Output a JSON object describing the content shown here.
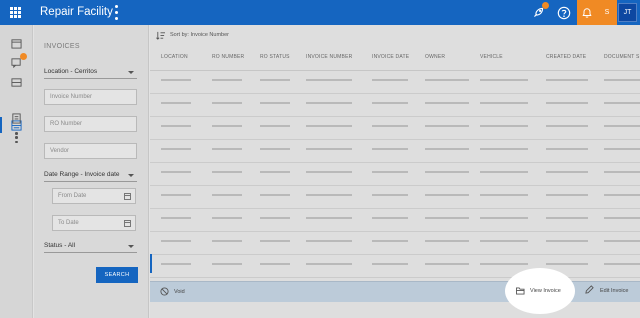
{
  "app": {
    "title": "Repair Facility"
  },
  "topbar": {
    "notification_count": "3",
    "user_initial": "S",
    "user_avatar": "JT"
  },
  "rail": {
    "messages_badge": ""
  },
  "filters": {
    "heading": "INVOICES",
    "location": "Location - Cerritos",
    "invoice_number_placeholder": "Invoice Number",
    "ro_number_placeholder": "RO Number",
    "vendor_placeholder": "Vendor",
    "date_range": "Date Range - Invoice date",
    "from_date_placeholder": "From Date",
    "to_date_placeholder": "To Date",
    "status": "Status - All",
    "search_label": "SEARCH"
  },
  "table": {
    "sort_label": "Sort by: Invoice Number",
    "columns": [
      "LOCATION",
      "RO NUMBER",
      "RO STATUS",
      "INVOICE NUMBER",
      "INVOICE DATE",
      "OWNER",
      "VEHICLE",
      "CREATED DATE",
      "DOCUMENT S"
    ]
  },
  "actions": {
    "void_label": "Void",
    "view_label": "View Invoice",
    "edit_label": "Edit Invoice"
  },
  "colors": {
    "primary": "#1565c0",
    "accent": "#f08a24",
    "highlight": "#ffffff"
  },
  "icons": [
    "apps-grid-icon",
    "kebab-menu-icon",
    "rocket-icon",
    "help-icon",
    "bell-icon",
    "calendar-icon",
    "sort-icon",
    "void-icon",
    "folder-open-icon",
    "edit-icon"
  ]
}
